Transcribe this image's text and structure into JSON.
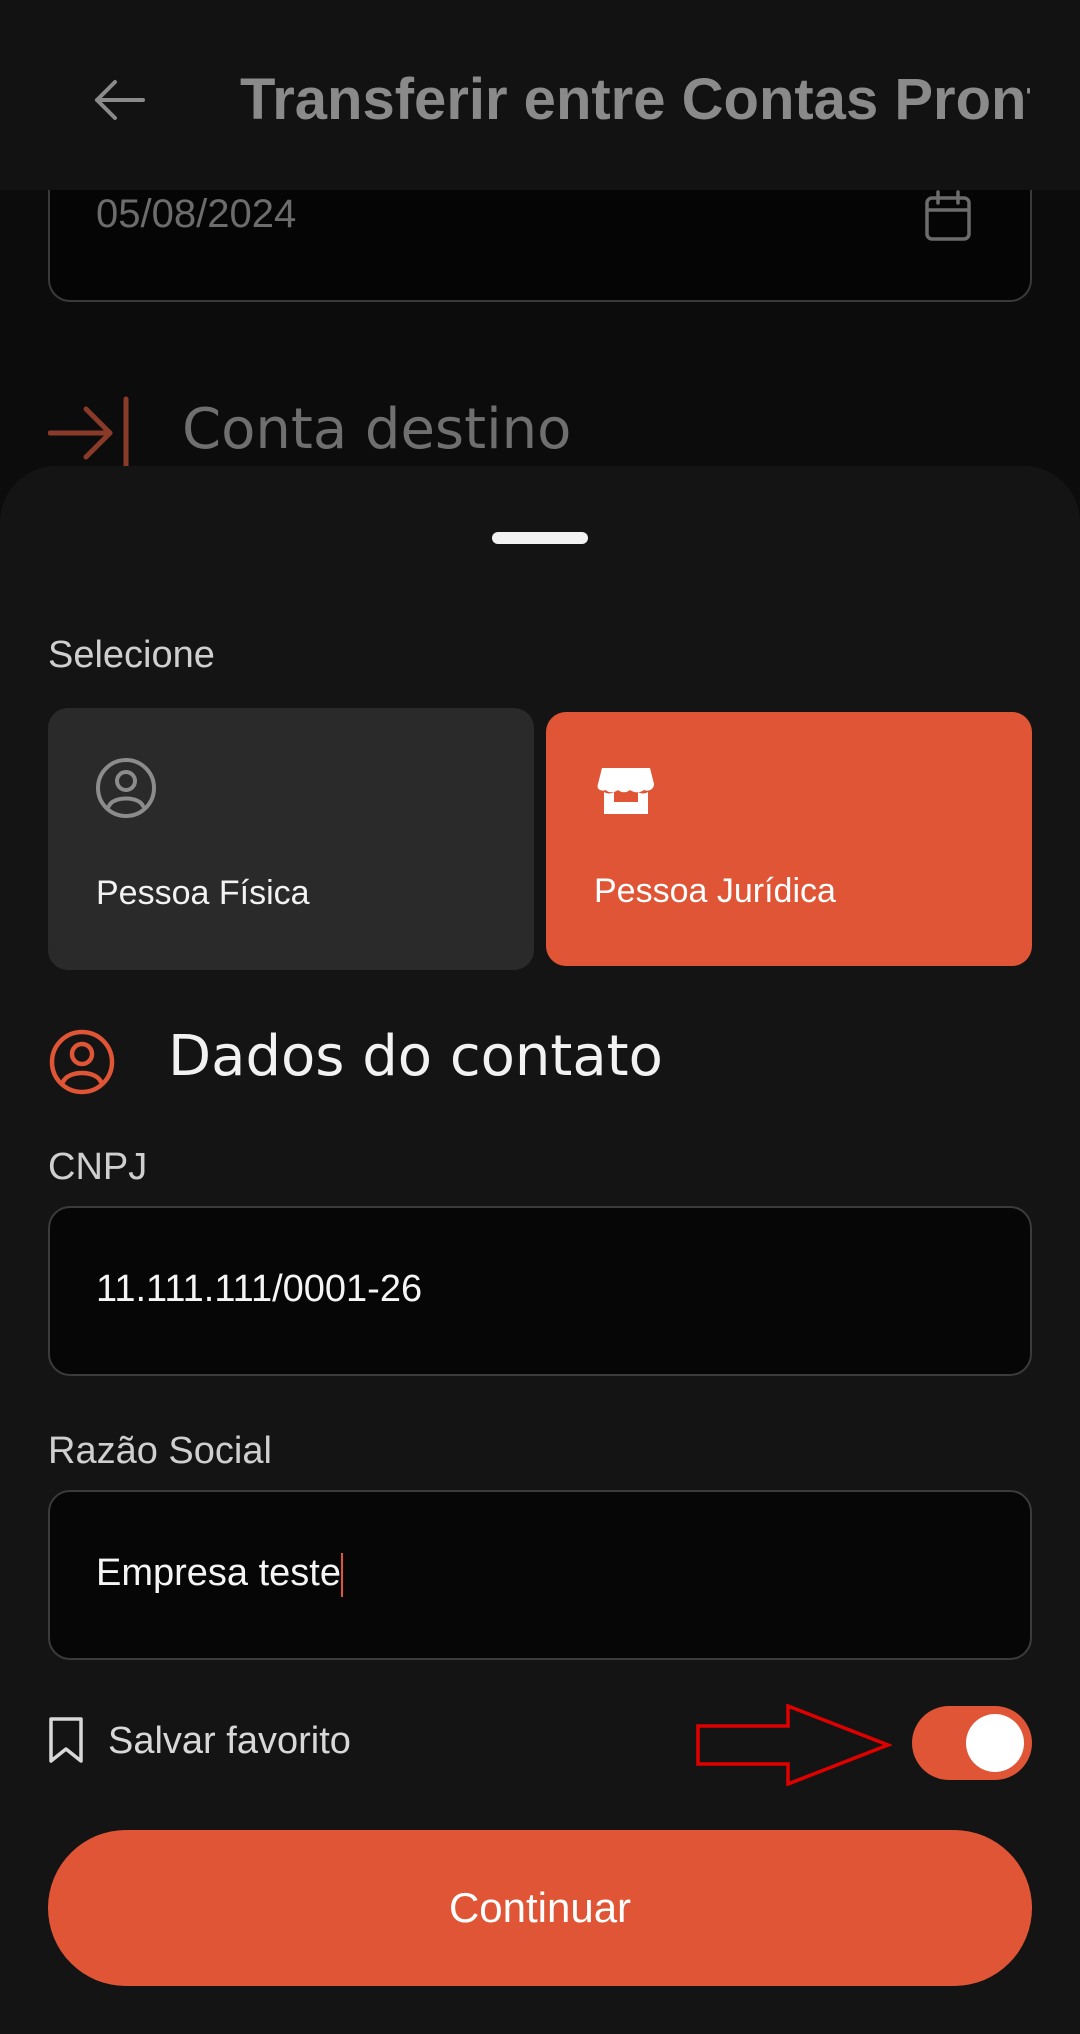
{
  "header": {
    "title": "Transferir entre Contas Pronta"
  },
  "background": {
    "date_value": "05/08/2024",
    "destination_title": "Conta destino"
  },
  "sheet": {
    "select_label": "Selecione",
    "person_types": [
      {
        "label": "Pessoa Física",
        "selected": false,
        "icon": "person-circle-icon"
      },
      {
        "label": "Pessoa Jurídica",
        "selected": true,
        "icon": "storefront-icon"
      }
    ],
    "contact_title": "Dados do contato",
    "fields": {
      "cnpj": {
        "label": "CNPJ",
        "value": "11.111.111/0001-26"
      },
      "razao_social": {
        "label": "Razão Social",
        "value": "Empresa teste"
      }
    },
    "favorite": {
      "label": "Salvar favorito",
      "enabled": true
    },
    "continue_label": "Continuar"
  },
  "colors": {
    "accent": "#e05535",
    "sheet_bg": "#141414",
    "card_bg": "#2a2a2a",
    "annotation_red": "#e00000"
  }
}
